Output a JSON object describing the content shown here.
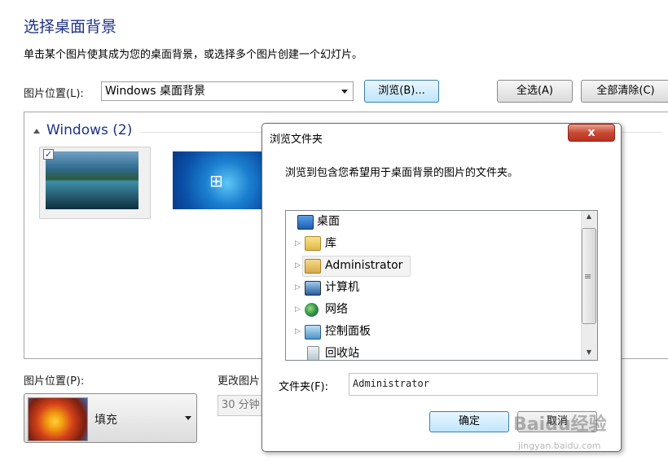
{
  "page": {
    "title": "选择桌面背景",
    "subtitle": "单击某个图片使其成为您的桌面背景，或选择多个图片创建一个幻灯片。",
    "location_label": "图片位置(L):",
    "location_value": "Windows 桌面背景",
    "browse_button": "浏览(B)...",
    "select_all_button": "全选(A)",
    "clear_all_button": "全部清除(C)"
  },
  "gallery": {
    "group_name": "Windows (2)",
    "items": [
      {
        "name": "landscape-lake",
        "checked": true
      },
      {
        "name": "windows-7-logo",
        "checked": false
      }
    ],
    "win_logo_glyph": "⊞"
  },
  "bottom": {
    "position_label": "图片位置(P):",
    "position_value": "填充",
    "change_label": "更改图片",
    "interval_value": "30 分钟"
  },
  "dialog": {
    "title": "浏览文件夹",
    "close_glyph": "x",
    "description": "浏览到包含您希望用于桌面背景的图片的文件夹。",
    "tree_items": [
      {
        "label": "桌面",
        "icon": "desktop-icon",
        "expandable": false
      },
      {
        "label": "库",
        "icon": "library-icon",
        "expandable": true
      },
      {
        "label": "Administrator",
        "icon": "user-folder-icon",
        "expandable": true,
        "selected": true
      },
      {
        "label": "计算机",
        "icon": "computer-icon",
        "expandable": true
      },
      {
        "label": "网络",
        "icon": "network-icon",
        "expandable": true
      },
      {
        "label": "控制面板",
        "icon": "control-panel-icon",
        "expandable": true
      },
      {
        "label": "回收站",
        "icon": "recycle-bin-icon",
        "expandable": false
      }
    ],
    "folder_label": "文件夹(F):",
    "folder_value": "Administrator",
    "ok_button": "确定",
    "cancel_button": "取消"
  },
  "watermark": {
    "line1": "Baidu经验",
    "line2": "jingyan.baidu.com"
  },
  "colors": {
    "title_blue": "#1e3287",
    "close_red": "#c74a34"
  }
}
